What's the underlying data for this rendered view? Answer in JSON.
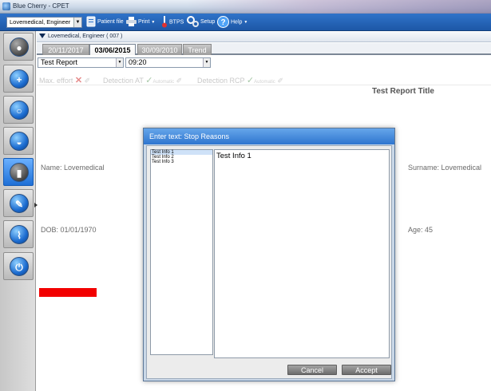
{
  "window": {
    "title": "Blue Cherry - CPET"
  },
  "toolbar": {
    "operator": "Lovemedical, Engineer",
    "patient_file": "Patient file",
    "print": "Print",
    "btps": "BTPS",
    "setup": "Setup",
    "help": "Help"
  },
  "patient": {
    "header": "Lovemedical, Engineer ( 007 )"
  },
  "tabs": [
    {
      "label": "20/11/2017",
      "active": false
    },
    {
      "label": "03/06/2015",
      "active": true
    },
    {
      "label": "30/09/2010",
      "active": false
    },
    {
      "label": "Trend",
      "active": false
    }
  ],
  "selectors": {
    "report": "Test Report",
    "time": "09:20"
  },
  "measurements": {
    "max_effort": "Max. effort",
    "detection_at": "Detection AT",
    "detection_at_mode": "Automatic",
    "detection_rcp": "Detection RCP",
    "detection_rcp_mode": "Automatic"
  },
  "report": {
    "title": "Test Report Title",
    "name": "Name:  Lovemedical",
    "surname": "Surname:  Lovemedical",
    "dob": "DOB:  01/01/1970",
    "age": "Age:  45"
  },
  "dialog": {
    "title": "Enter text: Stop Reasons",
    "items": [
      "Test Info 1",
      "Test Info 2",
      "Test Info 3"
    ],
    "text": "Test Info 1",
    "cancel": "Cancel",
    "accept": "Accept"
  },
  "colors": {
    "accent": "#2f73c9",
    "flag": "#f20000"
  }
}
